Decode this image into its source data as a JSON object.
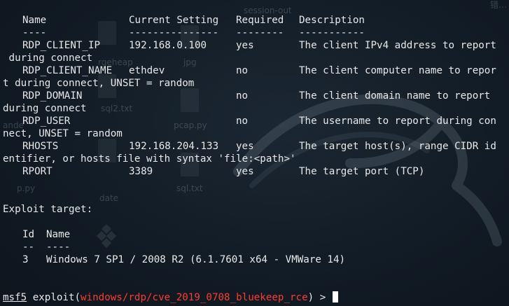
{
  "window": {
    "background_label_top": "session-out",
    "background_label_corner": "错…"
  },
  "desktop_ghosts": {
    "reqheap": "rgeheap",
    "jpg": "jpg",
    "sql2": "sql2.txt",
    "pcap": "pcap.py",
    "ande": "ande",
    "ppy": "p.py",
    "date": "date",
    "sqltxt": "sql.txt"
  },
  "options_table": {
    "headers": {
      "name": "Name",
      "current_setting": "Current Setting",
      "required": "Required",
      "description": "Description"
    },
    "underlines": {
      "name": "----",
      "current_setting": "---------------",
      "required": "--------",
      "description": "-----------"
    },
    "rows": [
      {
        "name": "RDP_CLIENT_IP",
        "current_setting": "192.168.0.100",
        "required": "yes",
        "description": "The client IPv4 address to report",
        "wrap": " during connect"
      },
      {
        "name": "RDP_CLIENT_NAME",
        "current_setting": "ethdev",
        "required": "no",
        "description": "The client computer name to repor",
        "wrap": "t during connect, UNSET = random"
      },
      {
        "name": "RDP_DOMAIN",
        "current_setting": "",
        "required": "no",
        "description": "The client domain name to report",
        "wrap": "during connect"
      },
      {
        "name": "RDP_USER",
        "current_setting": "",
        "required": "no",
        "description": "The username to report during con",
        "wrap": "nect, UNSET = random"
      },
      {
        "name": "RHOSTS",
        "current_setting": "192.168.204.133",
        "required": "yes",
        "description": "The target host(s), range CIDR id",
        "wrap": "entifier, or hosts file with syntax 'file:<path>'"
      },
      {
        "name": "RPORT",
        "current_setting": "3389",
        "required": "yes",
        "description": "The target port (TCP)",
        "wrap": ""
      }
    ]
  },
  "exploit_target": {
    "heading": "Exploit target:",
    "headers": {
      "id": "Id",
      "name": "Name"
    },
    "underlines": {
      "id": "--",
      "name": "----"
    },
    "row": {
      "id": "3",
      "name": "Windows 7 SP1 / 2008 R2 (6.1.7601 x64 - VMWare 14)"
    }
  },
  "prompt": {
    "prefix": "msf5",
    "command": " exploit(",
    "module": "windows/rdp/cve_2019_0708_bluekeep_rce",
    "suffix": ") > "
  },
  "colors": {
    "prompt_red": "#ff3b30",
    "text": "#e8e8e8",
    "background": "#121c26"
  }
}
